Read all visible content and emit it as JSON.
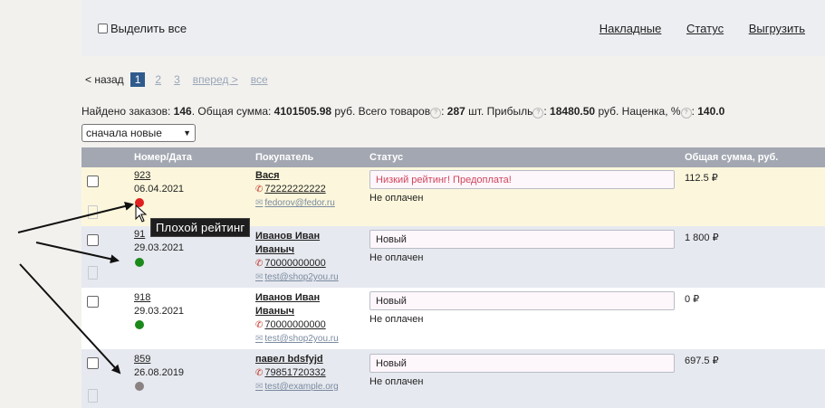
{
  "toolbar": {
    "select_all": "Выделить все",
    "links": [
      "Накладные",
      "Статус",
      "Выгрузить"
    ]
  },
  "pager": {
    "back": "< назад",
    "current": "1",
    "pages": [
      "2",
      "3",
      "вперед >",
      "все"
    ]
  },
  "summary": {
    "found_label": "Найдено заказов: ",
    "found": "146",
    "sum_label": ". Общая сумма: ",
    "sum": "4101505.98",
    "sum_unit": " руб. Всего товаров",
    "goods_sep": ": ",
    "goods": "287",
    "goods_unit": " шт. Прибыль",
    "profit_sep": ": ",
    "profit": "18480.50",
    "profit_unit": " руб. Наценка, %",
    "markup_sep": ": ",
    "markup": "140.0"
  },
  "sort": {
    "selected": "сначала новые"
  },
  "table": {
    "headers": [
      "Номер/Дата",
      "Покупатель",
      "Статус",
      "Общая сумма, руб."
    ]
  },
  "orders": [
    {
      "number": "923",
      "date": "06.04.2021",
      "dot_color": "#e02020",
      "buyer": "Вася",
      "phone": "72222222222",
      "email": "fedorov@fedor.ru",
      "status_text": "Низкий рейтинг! Предоплата!",
      "status_color": "#d0455c",
      "payment": "Не оплачен",
      "sum": "112.5 ₽",
      "bg": "#fcf7dc"
    },
    {
      "number": "91",
      "date": "29.03.2021",
      "dot_color": "#1b8a1b",
      "buyer": "Иванов Иван Иваныч",
      "phone": "70000000000",
      "email": "test@shop2you.ru",
      "status_text": "Новый",
      "status_color": "#222222",
      "payment": "Не оплачен",
      "sum": "1 800 ₽",
      "bg": "#e6e9ef"
    },
    {
      "number": "918",
      "date": "29.03.2021",
      "dot_color": "#1b8a1b",
      "buyer": "Иванов Иван Иваныч",
      "phone": "70000000000",
      "email": "test@shop2you.ru",
      "status_text": "Новый",
      "status_color": "#222222",
      "payment": "Не оплачен",
      "sum": "0 ₽",
      "bg": "#ffffff"
    },
    {
      "number": "859",
      "date": "26.08.2019",
      "dot_color": "#8a8282",
      "buyer": "павел bdsfyjd",
      "phone": "79851720332",
      "email": "test@example.org",
      "status_text": "Новый",
      "status_color": "#222222",
      "payment": "Не оплачен",
      "sum": "697.5 ₽",
      "bg": "#e6e9ef"
    }
  ],
  "tooltip": {
    "text": "Плохой рейтинг"
  }
}
